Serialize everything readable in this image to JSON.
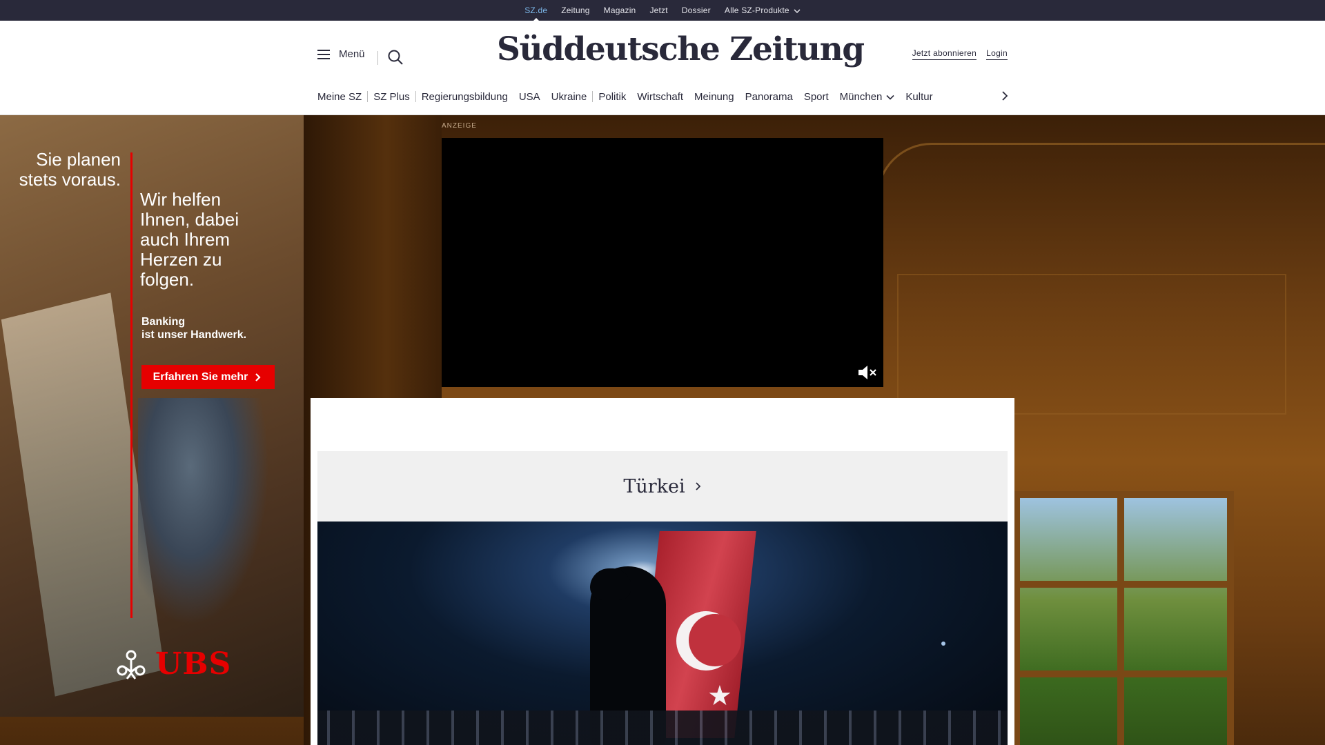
{
  "topbar": {
    "links": [
      "SZ.de",
      "Zeitung",
      "Magazin",
      "Jetzt",
      "Dossier",
      "Alle SZ-Produkte"
    ],
    "active_index": 0,
    "active_color": "#7bb6e8",
    "background": "#29293a"
  },
  "header": {
    "menu_label": "Menü",
    "logo_text": "Süddeutsche Zeitung",
    "subscribe_label": "Jetzt abonnieren",
    "login_label": "Login"
  },
  "nav": {
    "items": [
      "Meine SZ",
      "SZ Plus",
      "Regierungsbildung",
      "USA",
      "Ukraine",
      "Politik",
      "Wirtschaft",
      "Meinung",
      "Panorama",
      "Sport",
      "München",
      "Kultur"
    ],
    "dropdown_item": "München"
  },
  "ad_skyscraper": {
    "text_left": "Sie planen stets voraus.",
    "text_right": "Wir helfen Ihnen, dabei auch Ihrem Herzen zu folgen.",
    "tagline_line1": "Banking",
    "tagline_line2": "ist unser Handwerk.",
    "cta_label": "Erfahren Sie mehr",
    "brand": "UBS",
    "brand_color": "#e60000"
  },
  "ad_video": {
    "label": "ANZEIGE",
    "muted": true
  },
  "section": {
    "title": "Türkei"
  },
  "icons": [
    "hamburger-menu-icon",
    "search-icon",
    "chevron-down-icon",
    "chevron-right-icon",
    "mute-icon",
    "ubs-keys-logo-icon"
  ]
}
